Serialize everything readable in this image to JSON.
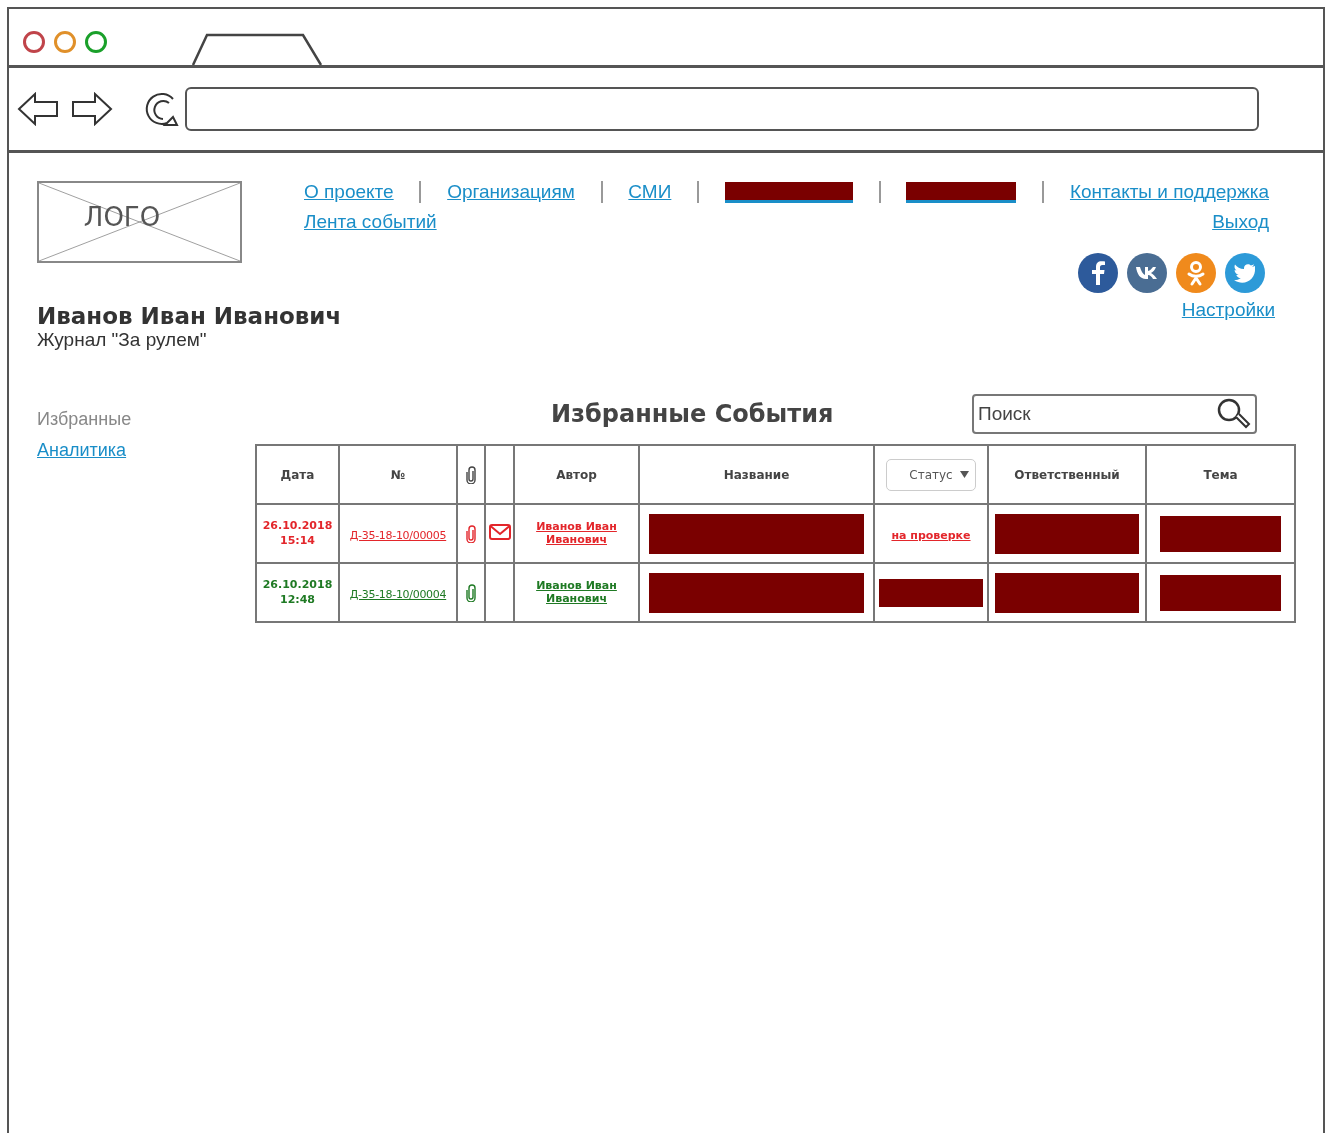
{
  "browser": {
    "tab": {
      "selected": true
    }
  },
  "logo": {
    "label": "ЛОГО"
  },
  "nav": [
    {
      "kind": "link",
      "label": "О проекте"
    },
    {
      "kind": "link",
      "label": "Организациям"
    },
    {
      "kind": "link",
      "label": "СМИ"
    },
    {
      "kind": "redacted"
    },
    {
      "kind": "redacted"
    },
    {
      "kind": "link",
      "label": "Контакты и поддержка"
    }
  ],
  "nav_second": {
    "label": "Лента событий"
  },
  "logout": {
    "label": "Выход"
  },
  "social": [
    {
      "kind": "facebook",
      "color": "#2d5a9b"
    },
    {
      "kind": "vk",
      "color": "#4a6d93"
    },
    {
      "kind": "ok",
      "color": "#f08a1c"
    },
    {
      "kind": "twitter",
      "color": "#2d9ad8"
    }
  ],
  "user": {
    "name": "Иванов Иван Иванович",
    "organization": "Журнал \"За рулем\""
  },
  "settings": {
    "label": "Настройки"
  },
  "sidebar": {
    "items": [
      {
        "label": "Избранные",
        "selected": true
      },
      {
        "label": "Аналитика",
        "selected": false
      }
    ]
  },
  "page_title": "Избранные События",
  "search": {
    "placeholder": "Поиск"
  },
  "table": {
    "columns": [
      {
        "kind": "text",
        "label": "Дата"
      },
      {
        "kind": "text",
        "label": "№"
      },
      {
        "kind": "clip"
      },
      {
        "kind": "blank"
      },
      {
        "kind": "text",
        "label": "Автор"
      },
      {
        "kind": "text",
        "label": "Название"
      },
      {
        "kind": "dropdown",
        "label": "Статус"
      },
      {
        "kind": "text",
        "label": "Ответственный"
      },
      {
        "kind": "text",
        "label": "Тема"
      }
    ],
    "rows": [
      {
        "color": "#e3262b",
        "date": "26.10.2018",
        "time": "15:14",
        "number": "Д-35-18-10/00005",
        "attachment": true,
        "mail": true,
        "author": "Иванов Иван Иванович",
        "title": {
          "kind": "redacted"
        },
        "status": {
          "kind": "text",
          "label": "на проверке"
        },
        "responsible": {
          "kind": "redacted"
        },
        "topic": {
          "kind": "redacted"
        }
      },
      {
        "color": "#1f7a24",
        "date": "26.10.2018",
        "time": "12:48",
        "number": "Д-35-18-10/00004",
        "attachment": true,
        "mail": false,
        "author": "Иванов Иван Иванович",
        "title": {
          "kind": "redacted"
        },
        "status": {
          "kind": "redacted"
        },
        "responsible": {
          "kind": "redacted"
        },
        "topic": {
          "kind": "redacted"
        }
      }
    ]
  }
}
